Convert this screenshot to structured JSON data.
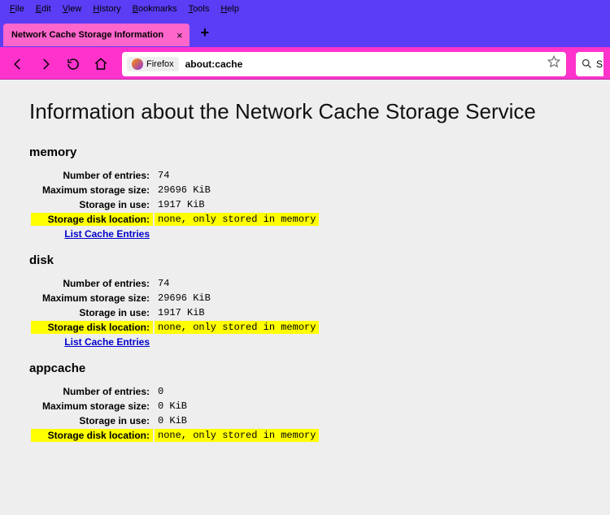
{
  "menubar": [
    "File",
    "Edit",
    "View",
    "History",
    "Bookmarks",
    "Tools",
    "Help"
  ],
  "tab": {
    "title": "Network Cache Storage Information"
  },
  "toolbar": {
    "ff_label": "Firefox",
    "url": "about:cache",
    "search_char": "S"
  },
  "page": {
    "heading": "Information about the Network Cache Storage Service",
    "labels": {
      "entries": "Number of entries:",
      "max": "Maximum storage size:",
      "inuse": "Storage in use:",
      "loc": "Storage disk location:",
      "link": "List Cache Entries"
    },
    "sections": [
      {
        "name": "memory",
        "entries": "74",
        "max": "29696 KiB",
        "inuse": "1917 KiB",
        "loc": "none, only stored in memory",
        "link": true
      },
      {
        "name": "disk",
        "entries": "74",
        "max": "29696 KiB",
        "inuse": "1917 KiB",
        "loc": "none, only stored in memory",
        "link": true
      },
      {
        "name": "appcache",
        "entries": "0",
        "max": "0 KiB",
        "inuse": "0 KiB",
        "loc": "none, only stored in memory",
        "link": false
      }
    ]
  }
}
